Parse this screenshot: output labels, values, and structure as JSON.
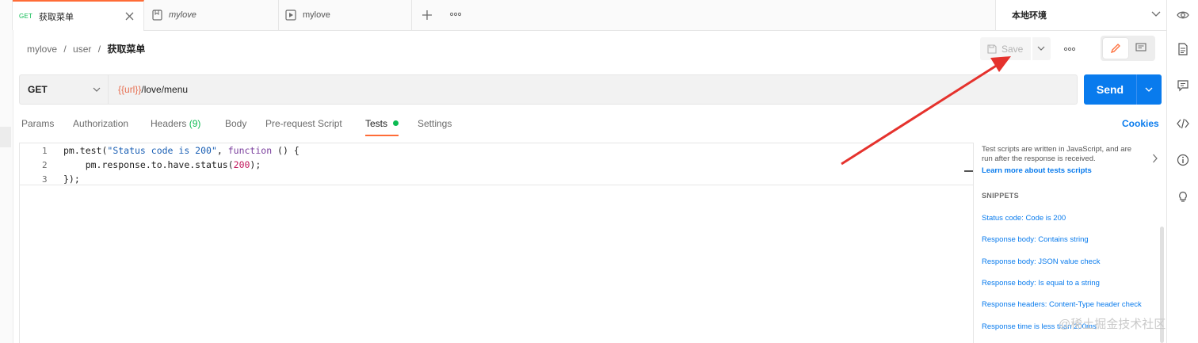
{
  "tabs": [
    {
      "method": "GET",
      "label": "获取菜单",
      "active": true
    },
    {
      "label": "mylove",
      "kind": "collection"
    },
    {
      "label": "mylove",
      "kind": "runner"
    }
  ],
  "environment": "本地环境",
  "breadcrumb": {
    "part1": "mylove",
    "sep": "/",
    "part2": "user",
    "current": "获取菜单"
  },
  "toolbar": {
    "save_label": "Save"
  },
  "request": {
    "method": "GET",
    "url_var": "{{url}}",
    "url_path": "/love/menu"
  },
  "send_label": "Send",
  "request_tabs": {
    "params": "Params",
    "authorization": "Authorization",
    "headers": "Headers",
    "headers_count": "(9)",
    "body": "Body",
    "prerequest": "Pre-request Script",
    "tests": "Tests",
    "settings": "Settings",
    "cookies": "Cookies"
  },
  "editor": {
    "line_numbers": [
      "1",
      "2",
      "3"
    ],
    "line1": {
      "a": "pm.test(",
      "b": "\"Status code is 200\"",
      "c": ", ",
      "d": "function",
      "e": " () {"
    },
    "line2": {
      "a": "    pm.response.to.have.status(",
      "b": "200",
      "c": ");"
    },
    "line3": "});"
  },
  "panel": {
    "description": "Test scripts are written in JavaScript, and are run after the response is received.",
    "learn_more": "Learn more about tests scripts",
    "snippets_heading": "SNIPPETS",
    "snippets": [
      "Status code: Code is 200",
      "Response body: Contains string",
      "Response body: JSON value check",
      "Response body: Is equal to a string",
      "Response headers: Content-Type header check",
      "Response time is less than 200ms"
    ]
  },
  "watermark": "@稀土掘金技术社区",
  "colors": {
    "accent": "#ff6c37",
    "send": "#097bed",
    "annotation_arrow": "#e5322d",
    "get_method": "#0cbb52"
  }
}
